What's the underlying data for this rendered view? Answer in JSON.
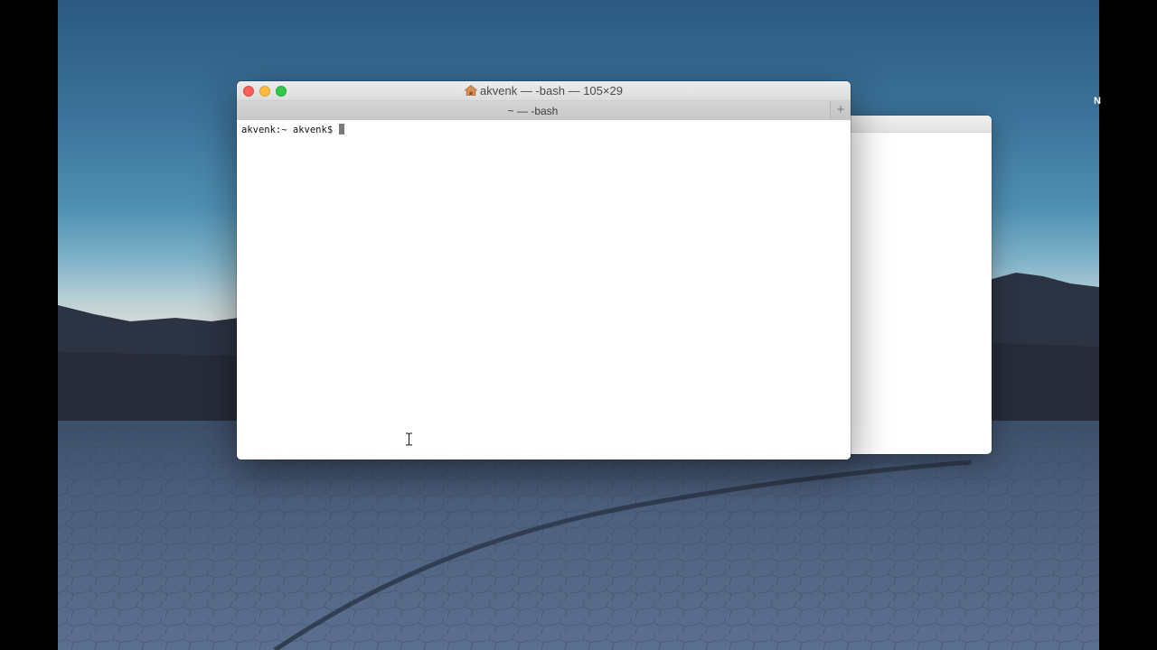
{
  "desktop": {
    "edge_glyph": "N"
  },
  "terminal": {
    "window_title": "akvenk — -bash — 105×29",
    "title_icon": "home-icon",
    "tab_title": "~ — -bash",
    "new_tab_label": "+",
    "prompt": "akvenk:~ akvenk$ ",
    "controls": [
      "close",
      "minimize",
      "zoom"
    ]
  },
  "pointer": {
    "type": "ibeam"
  },
  "colors": {
    "close": "#fc605c",
    "minimize": "#fdbc40",
    "zoom": "#34c84a"
  }
}
